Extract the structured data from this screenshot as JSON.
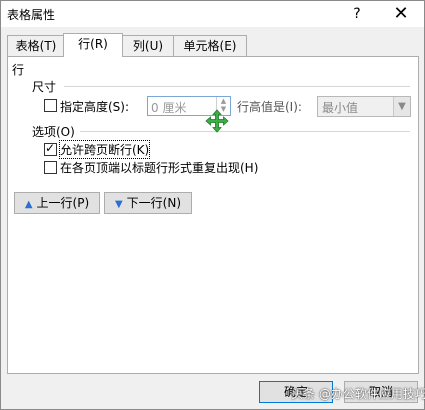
{
  "window": {
    "title": "表格属性",
    "help_label": "?",
    "close_label": "✕"
  },
  "tabs": [
    {
      "label": "表格(T)",
      "active": false
    },
    {
      "label": "行(R)",
      "active": true
    },
    {
      "label": "列(U)",
      "active": false
    },
    {
      "label": "单元格(E)",
      "active": false
    }
  ],
  "panel": {
    "heading": "行",
    "size_section": "尺寸",
    "specify_height_label": "指定高度(S):",
    "specify_height_checked": false,
    "height_value": "0 厘米",
    "row_height_is_label": "行高值是(I):",
    "row_height_option": "最小值",
    "options_section": "选项(O)",
    "allow_break_label": "允许跨页断行(K)",
    "allow_break_checked": true,
    "repeat_header_label": "在各页顶端以标题行形式重复出现(H)",
    "repeat_header_checked": false,
    "prev_row_label": "上一行(P)",
    "next_row_label": "下一行(N)"
  },
  "footer": {
    "ok_label": "确定",
    "cancel_label": "取消",
    "watermark": "头条 @办公软件应用技巧"
  },
  "icons": {
    "move_cursor": "move-cursor-icon",
    "move_cursor_color": "#3cb043",
    "arrow_color": "#2c6fd0"
  }
}
